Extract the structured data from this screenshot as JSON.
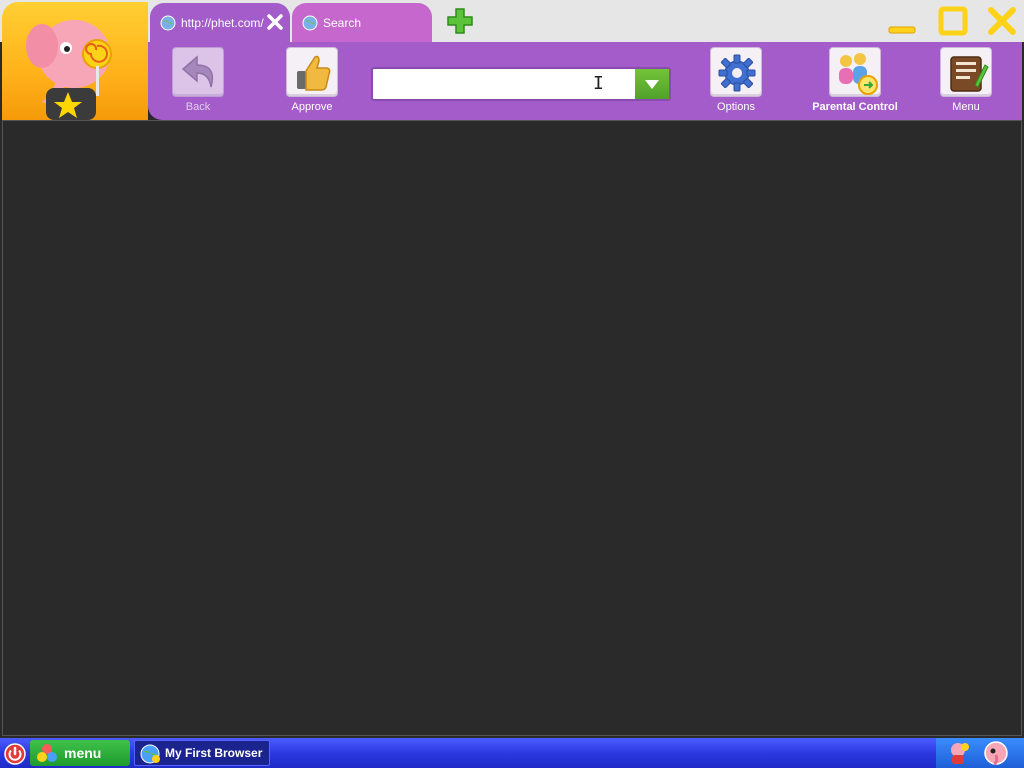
{
  "tabs": [
    {
      "label": "http://phet.com/",
      "active": true
    },
    {
      "label": "Search",
      "active": false
    }
  ],
  "toolbar": {
    "back_label": "Back",
    "approve_label": "Approve",
    "options_label": "Options",
    "parental_label": "Parental Control",
    "menu_label": "Menu"
  },
  "address": {
    "value": "",
    "placeholder": ""
  },
  "taskbar": {
    "menu_label": "menu",
    "task_label": "My First Browser"
  },
  "colors": {
    "accent_purple": "#a35cc9",
    "tab_inactive": "#c667cd",
    "taskbar_blue": "#2b39e0",
    "logo_orange": "#ffb21a",
    "content_bg": "#2a2a2a"
  },
  "icons": [
    "elephant-logo",
    "globe-icon",
    "close-icon",
    "plus-icon",
    "minimize-icon",
    "maximize-icon",
    "back-arrow-icon",
    "thumbs-up-icon",
    "gear-icon",
    "parental-people-icon",
    "notebook-icon",
    "dropdown-arrow-icon",
    "power-icon",
    "menu-balls-icon",
    "browser-globe-icon"
  ]
}
